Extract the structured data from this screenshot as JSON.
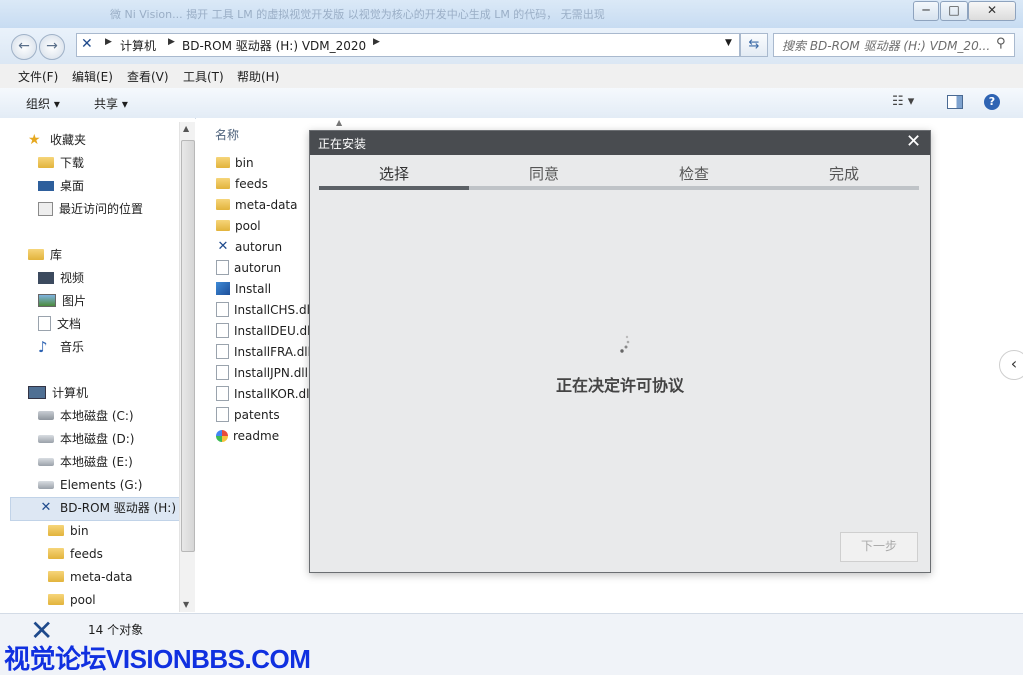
{
  "window": {
    "title": "微 Ni Vision... 揭开 工具 LM 的虚拟视觉开发版 以视觉为核心的开发中心生成 LM 的代码， 无需出现"
  },
  "titlebar_buttons": {
    "minimize": "─",
    "maximize": "□",
    "close": "✕"
  },
  "address": {
    "crumbs": [
      "计算机",
      "BD-ROM 驱动器 (H:) VDM_2020"
    ],
    "search_placeholder": "搜索 BD-ROM 驱动器 (H:) VDM_20..."
  },
  "menu": [
    "文件(F)",
    "编辑(E)",
    "查看(V)",
    "工具(T)",
    "帮助(H)"
  ],
  "toolbar": {
    "organize": "组织 ▾",
    "share": "共享 ▾"
  },
  "nav": {
    "favorites": {
      "label": "收藏夹",
      "items": [
        "下载",
        "桌面",
        "最近访问的位置"
      ]
    },
    "libraries": {
      "label": "库",
      "items": [
        "视频",
        "图片",
        "文档",
        "音乐"
      ]
    },
    "computer": {
      "label": "计算机",
      "items": [
        "本地磁盘 (C:)",
        "本地磁盘 (D:)",
        "本地磁盘 (E:)",
        "Elements (G:)",
        "BD-ROM 驱动器 (H:)"
      ]
    },
    "subfolders": [
      "bin",
      "feeds",
      "meta-data",
      "pool"
    ]
  },
  "columns": {
    "name": "名称"
  },
  "files": [
    {
      "name": "bin",
      "type": "folder"
    },
    {
      "name": "feeds",
      "type": "folder"
    },
    {
      "name": "meta-data",
      "type": "folder"
    },
    {
      "name": "pool",
      "type": "folder"
    },
    {
      "name": "autorun",
      "type": "ni"
    },
    {
      "name": "autorun",
      "type": "settings"
    },
    {
      "name": "Install",
      "type": "app"
    },
    {
      "name": "InstallCHS.dll",
      "type": "dll"
    },
    {
      "name": "InstallDEU.dll",
      "type": "dll"
    },
    {
      "name": "InstallFRA.dll",
      "type": "dll"
    },
    {
      "name": "InstallJPN.dll",
      "type": "dll"
    },
    {
      "name": "InstallKOR.dll",
      "type": "dll"
    },
    {
      "name": "patents",
      "type": "doc"
    },
    {
      "name": "readme",
      "type": "html"
    }
  ],
  "status": {
    "count": "14 个对象"
  },
  "watermark": "视觉论坛VISIONBBS.COM",
  "dialog": {
    "title": "正在安装",
    "close": "✕",
    "steps": [
      "选择",
      "同意",
      "检查",
      "完成"
    ],
    "progress": 0.25,
    "message": "正在决定许可协议",
    "next": "下一步"
  },
  "side_arrow": "‹"
}
